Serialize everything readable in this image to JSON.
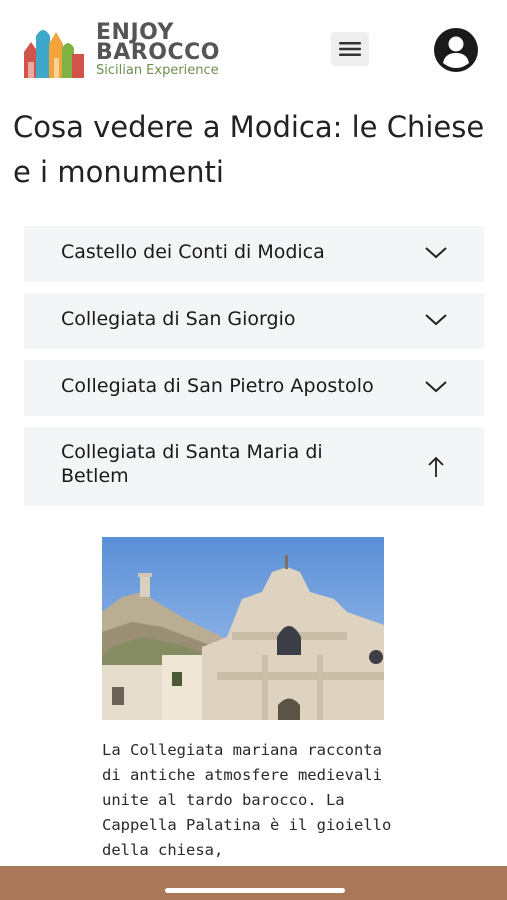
{
  "header": {
    "logo": {
      "line1": "ENJOY",
      "line2": "BAROCCO",
      "tagline": "Sicilian Experience"
    },
    "menu_icon": "hamburger-menu-icon",
    "account_icon": "user-account-icon"
  },
  "page": {
    "title": "Cosa vedere a Modica: le Chiese e i monumenti"
  },
  "accordion": {
    "items": [
      {
        "label": "Castello dei Conti di Modica",
        "state": "collapsed",
        "icon": "chevron-down-icon"
      },
      {
        "label": "Collegiata di San Giorgio",
        "state": "collapsed",
        "icon": "chevron-down-icon"
      },
      {
        "label": "Collegiata di San Pietro Apostolo",
        "state": "collapsed",
        "icon": "chevron-down-icon"
      },
      {
        "label": "Collegiata di Santa Maria di Betlem",
        "state": "expanded",
        "icon": "arrow-up-icon"
      }
    ]
  },
  "content": {
    "photo": "church-facade-photo",
    "description": "La Collegiata mariana racconta di antiche atmosfere medievali unite al tardo barocco. La Cappella Palatina è il gioiello della chiesa,"
  },
  "colors": {
    "accordion_bg": "#f4f5f6",
    "bottom_bar": "#a9775a",
    "logo_text": "#555555",
    "tagline": "#6d8f4e"
  }
}
